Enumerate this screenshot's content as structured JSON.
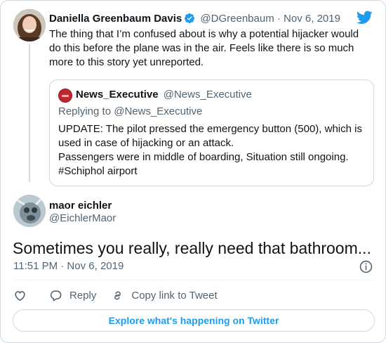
{
  "parent_tweet": {
    "author_name": "Daniella Greenbaum Davis",
    "author_handle": "@DGreenbaum",
    "separator": "·",
    "date": "Nov 6, 2019",
    "text": "The thing that I’m confused about is why a potential hijacker would do this before the plane was in the air. Feels like there is so much more to this story yet unreported.",
    "verified": true
  },
  "quoted_tweet": {
    "author_name": "News_Executive",
    "author_handle": "@News_Executive",
    "replying_to_label": "Replying to",
    "replying_to_handle": "@News_Executive",
    "lines": [
      "UPDATE: The pilot pressed the emergency button (500), which is used in case of hijacking or an attack.",
      "Passengers were in middle of boarding, Situation still ongoing.",
      "#Schiphol airport"
    ]
  },
  "main_tweet": {
    "author_name": "maor eichler",
    "author_handle": "@EichlerMaor",
    "text": "Sometimes you really, really need that bathroom...",
    "timestamp": "11:51 PM · Nov 6, 2019"
  },
  "actions": {
    "reply_label": "Reply",
    "copy_link_label": "Copy link to Tweet"
  },
  "explore_button": "Explore what's happening on Twitter",
  "colors": {
    "twitter_blue": "#1d9bf0",
    "text_primary": "#0f1419",
    "text_secondary": "#536471",
    "border": "#cfd9de"
  }
}
